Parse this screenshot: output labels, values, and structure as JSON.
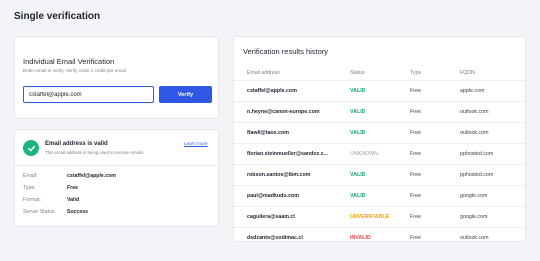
{
  "page": {
    "title": "Single verification"
  },
  "verify_card": {
    "title": "Individual Email Verification",
    "subtitle": "Enter email to verify. Verify costs 1 credit per email",
    "input_value": "cstaffel@apple.com",
    "button_label": "Verify"
  },
  "result_card": {
    "icon": "check-icon",
    "title": "Email address is valid",
    "subtitle": "This email address is being used to receive emails.",
    "learn_more": "Learn more",
    "details": [
      {
        "label": "Email:",
        "value": "cstaffel@apple.com"
      },
      {
        "label": "Type:",
        "value": "Free"
      },
      {
        "label": "Format:",
        "value": "Valid"
      },
      {
        "label": "Server Status:",
        "value": "Success"
      }
    ]
  },
  "history": {
    "title": "Verification results history",
    "columns": {
      "email": "Email address",
      "status": "Status",
      "type": "Type",
      "fqdn": "FQDN"
    },
    "rows": [
      {
        "email": "cstaffel@apple.com",
        "status": "VALID",
        "status_kind": "valid",
        "type": "Free",
        "fqdn": "apple.com"
      },
      {
        "email": "n.heyne@canon-europe.com",
        "status": "VALID",
        "status_kind": "valid",
        "type": "Free",
        "fqdn": "outlook.com"
      },
      {
        "email": "ftawil@taos.com",
        "status": "VALID",
        "status_kind": "valid",
        "type": "Free",
        "fqdn": "outlook.com"
      },
      {
        "email": "florian.steinmueller@sandoz.c...",
        "status": "UNKNOWN",
        "status_kind": "unknown",
        "type": "Free",
        "fqdn": "pphosted.com"
      },
      {
        "email": "robson.santos@ibm.com",
        "status": "VALID",
        "status_kind": "valid",
        "type": "Free",
        "fqdn": "pphosted.com"
      },
      {
        "email": "paul@madkudu.com",
        "status": "VALID",
        "status_kind": "valid",
        "type": "Free",
        "fqdn": "google.com"
      },
      {
        "email": "caguilera@saam.cl",
        "status": "UNVERIFIABLE",
        "status_kind": "unverifiable",
        "type": "Free",
        "fqdn": "google.com"
      },
      {
        "email": "dsdzanto@sodimac.cl",
        "status": "INVALID",
        "status_kind": "invalid",
        "type": "Free",
        "fqdn": "outlook.com"
      }
    ]
  },
  "colors": {
    "accent": "#2f58e6",
    "valid": "#16a869",
    "unknown": "#9aa0ab",
    "unverifiable": "#f59e0b",
    "invalid": "#ef4444",
    "success_icon": "#19b37b"
  }
}
